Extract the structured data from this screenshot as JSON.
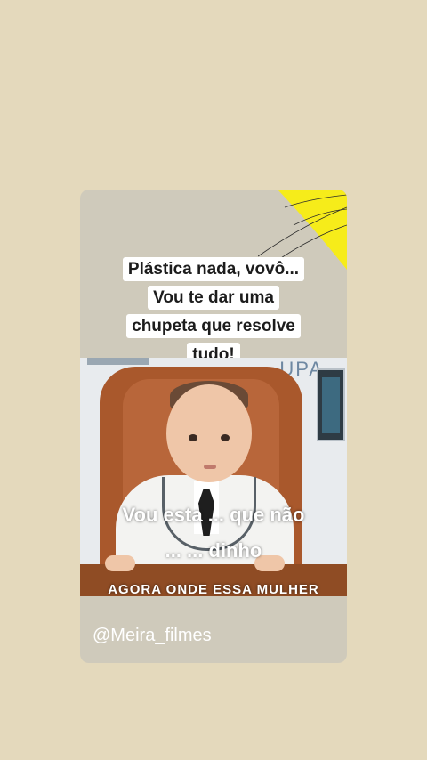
{
  "caption": {
    "lines": [
      "Plástica nada, vovô...",
      "Vou te dar uma",
      "chupeta que resolve",
      "tudo!"
    ]
  },
  "photo": {
    "sign": "UPA",
    "subtitle_line_1": "Vou esta ... que não",
    "subtitle_line_2": "... ... dinho",
    "subtitle_line_3": "AGORA ONDE ESSA MULHER"
  },
  "watermark": "@Meira_filmes",
  "colors": {
    "background": "#e4d9bc",
    "card": "#cfcabb",
    "sun": "#f6ec1a"
  }
}
